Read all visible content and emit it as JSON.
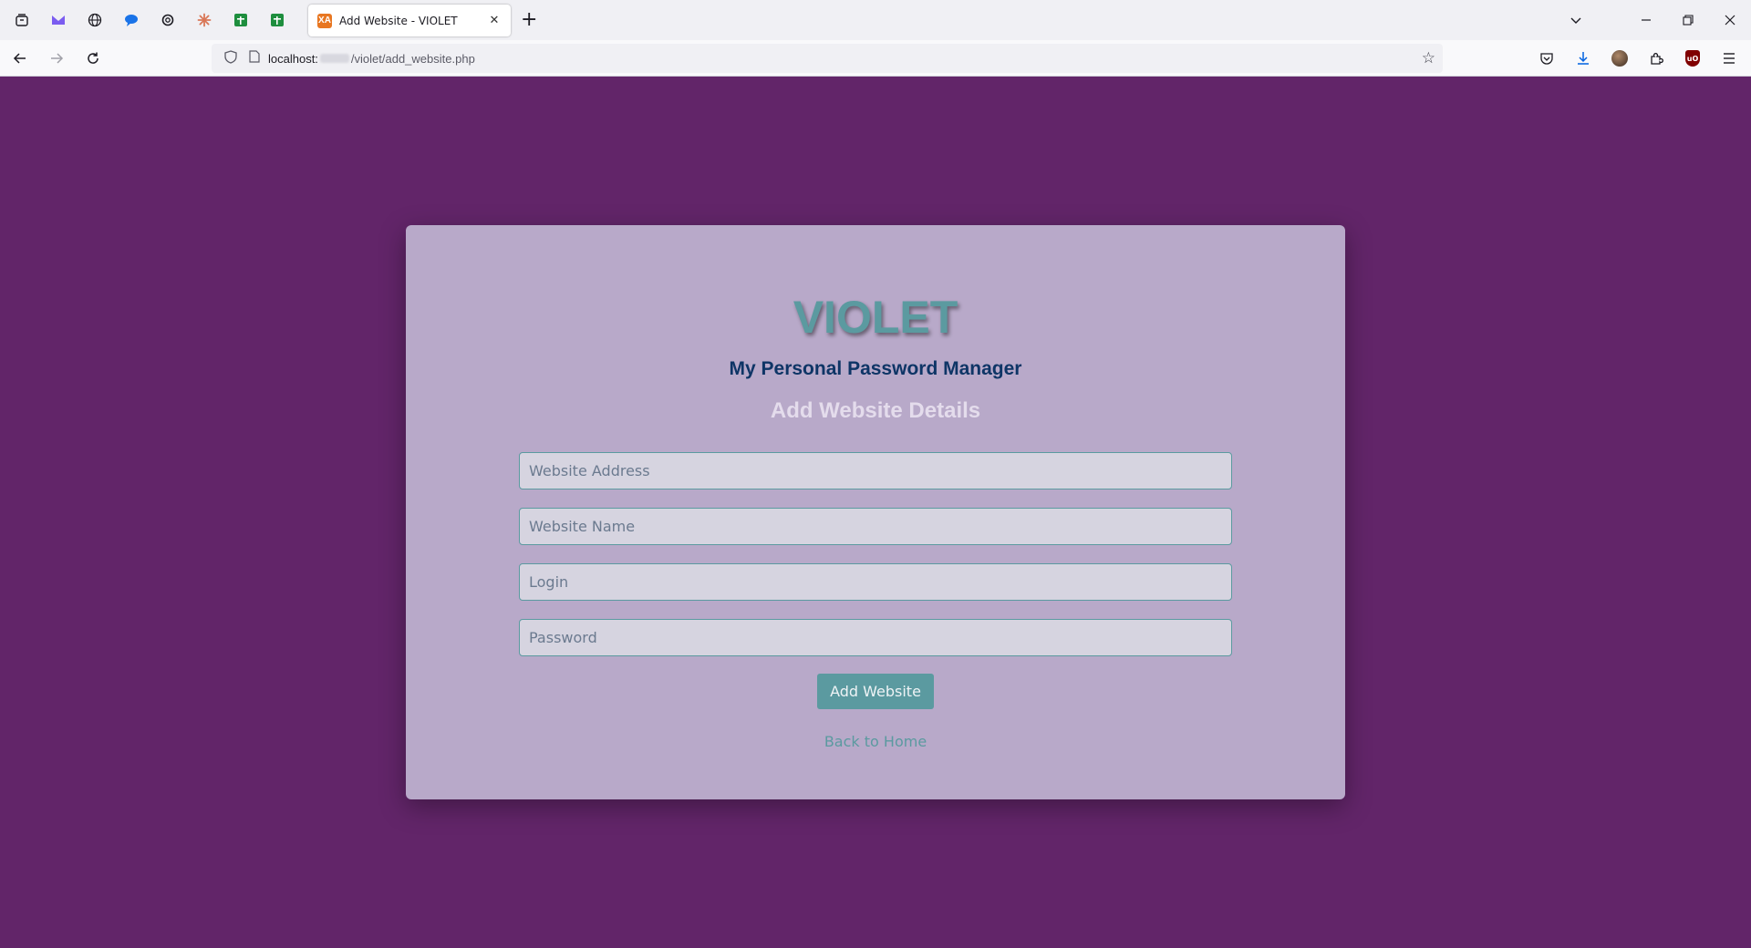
{
  "browser": {
    "pinned_tabs": [
      {
        "icon": "tab-overview-icon"
      },
      {
        "icon": "proton-mail-icon"
      },
      {
        "icon": "globe-icon"
      },
      {
        "icon": "chat-bubble-icon"
      },
      {
        "icon": "openai-icon"
      },
      {
        "icon": "claude-asterisk-icon"
      },
      {
        "icon": "sheets-icon"
      },
      {
        "icon": "sheets-icon"
      }
    ],
    "active_tab": {
      "title": "Add Website - VIOLET",
      "favicon_letter": "XA"
    },
    "url": {
      "host": "localhost:",
      "path": "/violet/add_website.php"
    }
  },
  "page": {
    "logo": "VIOLET",
    "subtitle": "My Personal Password Manager",
    "section_title": "Add Website Details",
    "fields": {
      "website_address": "Website Address",
      "website_name": "Website Name",
      "login": "Login",
      "password": "Password"
    },
    "submit_label": "Add Website",
    "back_link": "Back to Home"
  },
  "colors": {
    "background": "#622569",
    "card": "#b8a9c9",
    "accent": "#5b9aa0",
    "subtitle": "#0e3566"
  }
}
